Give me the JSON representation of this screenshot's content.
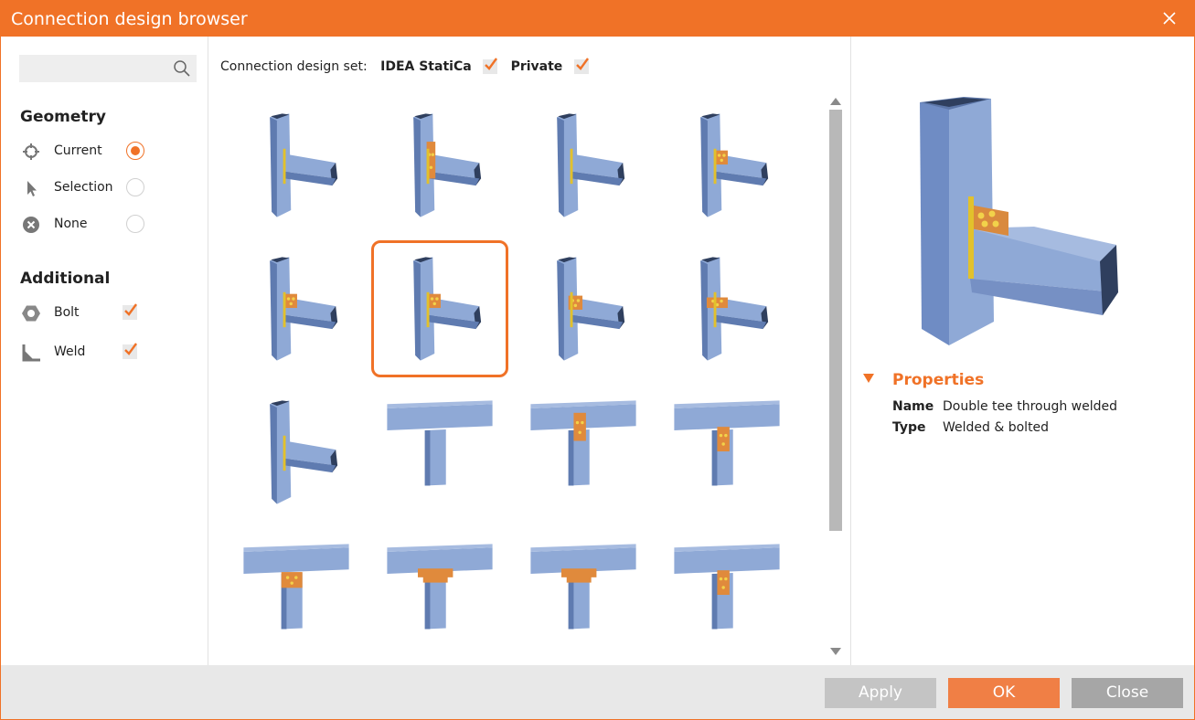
{
  "window": {
    "title": "Connection design browser"
  },
  "search": {
    "placeholder": "",
    "value": ""
  },
  "geometry": {
    "title": "Geometry",
    "options": [
      {
        "label": "Current",
        "icon": "crosshair-icon",
        "selected": true
      },
      {
        "label": "Selection",
        "icon": "cursor-arrow-icon",
        "selected": false
      },
      {
        "label": "None",
        "icon": "circle-x-icon",
        "selected": false
      }
    ]
  },
  "additional": {
    "title": "Additional",
    "options": [
      {
        "label": "Bolt",
        "icon": "hex-nut-icon",
        "checked": true
      },
      {
        "label": "Weld",
        "icon": "weld-angle-icon",
        "checked": true
      }
    ]
  },
  "design_set": {
    "label": "Connection design set:",
    "items": [
      {
        "label": "IDEA StatiCa",
        "checked": true
      },
      {
        "label": "Private",
        "checked": true
      }
    ]
  },
  "gallery": {
    "selected_index": 5,
    "count": 16
  },
  "properties": {
    "title": "Properties",
    "rows": [
      {
        "key": "Name",
        "value": "Double tee through welded"
      },
      {
        "key": "Type",
        "value": "Welded & bolted"
      }
    ]
  },
  "footer": {
    "apply": "Apply",
    "ok": "OK",
    "close": "Close"
  },
  "colors": {
    "accent": "#f07227",
    "steel": "#8fa9d6",
    "steel_dark": "#5f7bb0",
    "plate": "#e08a3c"
  }
}
